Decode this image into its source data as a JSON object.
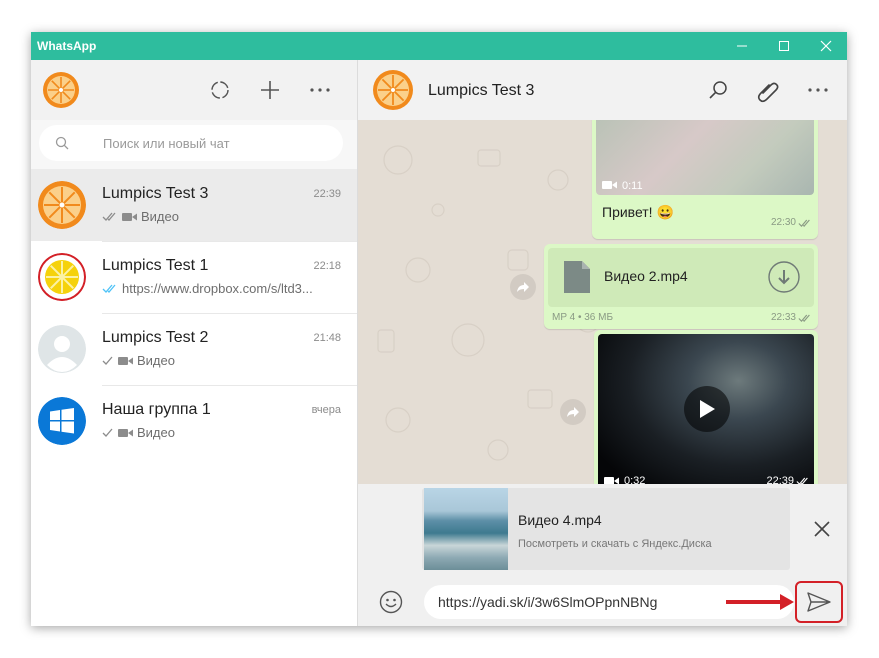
{
  "app": {
    "title": "WhatsApp",
    "accent": "#2ebd9e"
  },
  "window_controls": [
    "minimize-icon",
    "maximize-icon",
    "close-icon"
  ],
  "left_header": {
    "icons": [
      "status-icon",
      "plus-icon",
      "more-icon"
    ]
  },
  "search": {
    "placeholder": "Поиск или новый чат"
  },
  "chats": [
    {
      "name": "Lumpics Test 3",
      "time": "22:39",
      "preview": "Видео",
      "ticks": "double-gray",
      "media": "video",
      "avatar": "orange",
      "active": true
    },
    {
      "name": "Lumpics Test 1",
      "time": "22:18",
      "preview": "https://www.dropbox.com/s/ltd3...",
      "ticks": "double-blue",
      "media": "none",
      "avatar": "lemon",
      "active": false
    },
    {
      "name": "Lumpics Test 2",
      "time": "21:48",
      "preview": "Видео",
      "ticks": "single",
      "media": "video",
      "avatar": "default",
      "active": false
    },
    {
      "name": "Наша группа 1",
      "time": "вчера",
      "preview": "Видео",
      "ticks": "single",
      "media": "video",
      "avatar": "windows",
      "active": false
    }
  ],
  "conversation": {
    "contact_name": "Lumpics Test 3",
    "header_icons": [
      "search-icon",
      "paperclip-icon",
      "more-icon"
    ],
    "messages": {
      "video1": {
        "duration": "0:11",
        "caption": "Привет! 😀",
        "time": "22:30"
      },
      "file": {
        "filename": "Видео 2.mp4",
        "meta": "MP 4 • 36 МБ",
        "time": "22:33"
      },
      "video2": {
        "duration": "0:32",
        "time": "22:39"
      }
    },
    "link_preview": {
      "title": "Видео 4.mp4",
      "description": "Посмотреть и скачать с Яндекс.Диска"
    },
    "input": {
      "value": "https://yadi.sk/i/3w6SlmOPpnNBNg"
    }
  },
  "colors": {
    "outgoing_bubble": "#dcf8c6",
    "chat_bg": "#e4ddd4",
    "highlight": "#d32027",
    "read_ticks": "#4fc3f7"
  }
}
